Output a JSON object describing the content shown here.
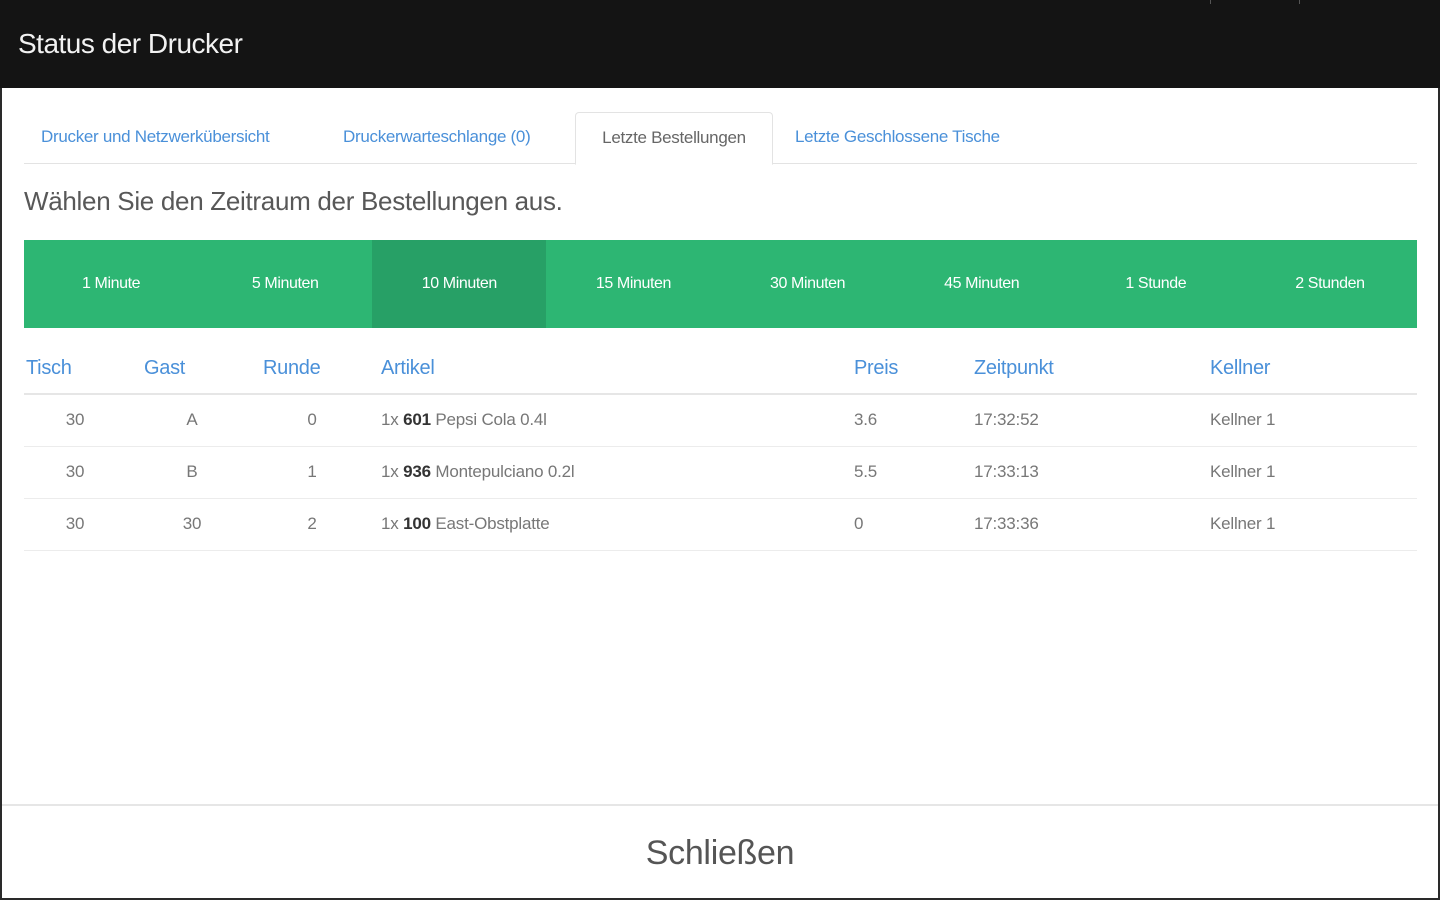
{
  "window": {
    "title": "Status der Drucker"
  },
  "tabs": [
    {
      "label": "Drucker und Netzwerkübersicht",
      "active": false
    },
    {
      "label": "Druckerwarteschlange (0)",
      "active": false
    },
    {
      "label": "Letzte Bestellungen",
      "active": true
    },
    {
      "label": "Letzte Geschlossene Tische",
      "active": false
    }
  ],
  "prompt": "Wählen Sie den Zeitraum der Bestellungen aus.",
  "time_ranges": {
    "options": [
      "1 Minute",
      "5 Minuten",
      "10 Minuten",
      "15 Minuten",
      "30 Minuten",
      "45 Minuten",
      "1 Stunde",
      "2 Stunden"
    ],
    "selected": "10 Minuten"
  },
  "orders": {
    "columns": [
      "Tisch",
      "Gast",
      "Runde",
      "Artikel",
      "Preis",
      "Zeitpunkt",
      "Kellner"
    ],
    "rows": [
      {
        "tisch": "30",
        "gast": "A",
        "runde": "0",
        "qty": "1x",
        "code": "601",
        "name": "Pepsi Cola 0.4l",
        "preis": "3.6",
        "zeitpunkt": "17:32:52",
        "kellner": "Kellner 1"
      },
      {
        "tisch": "30",
        "gast": "B",
        "runde": "1",
        "qty": "1x",
        "code": "936",
        "name": "Montepulciano 0.2l",
        "preis": "5.5",
        "zeitpunkt": "17:33:13",
        "kellner": "Kellner 1"
      },
      {
        "tisch": "30",
        "gast": "30",
        "runde": "2",
        "qty": "1x",
        "code": "100",
        "name": "East-Obstplatte",
        "preis": "0",
        "zeitpunkt": "17:33:36",
        "kellner": "Kellner 1"
      }
    ]
  },
  "footer": {
    "close_label": "Schließen"
  },
  "colors": {
    "header_bg": "#141414",
    "accent_green": "#2db673",
    "selected_green": "#27a066",
    "link_blue": "#4a90d9"
  }
}
